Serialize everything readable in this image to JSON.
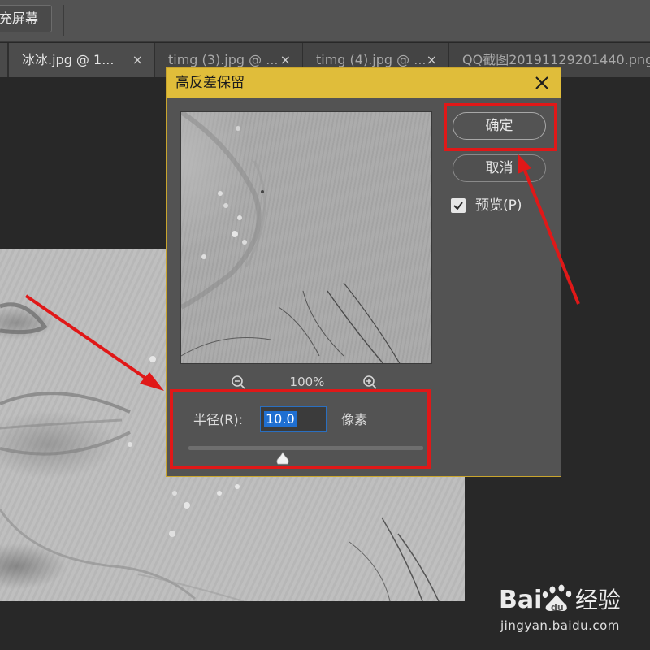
{
  "toolbar": {
    "fullscreen_label": "充屏幕"
  },
  "tabs": [
    {
      "label": "冰冰.jpg @ 1...",
      "close": "×",
      "active": true
    },
    {
      "label": "timg (3).jpg @ ...",
      "close": "×",
      "active": false
    },
    {
      "label": "timg (4).jpg @ ...",
      "close": "×",
      "active": false
    },
    {
      "label": "QQ截图20191129201440.png",
      "close": "",
      "active": false
    }
  ],
  "dialog": {
    "title": "高反差保留",
    "zoom": "100%",
    "radius_label": "半径(R):",
    "radius_value": "10.0",
    "unit": "像素",
    "radius_slider_fraction": 0.4,
    "ok_label": "确定",
    "cancel_label": "取消",
    "preview_label": "预览(P)",
    "preview_checked": true
  },
  "watermark": {
    "logo_text": "Baidu经验",
    "url": "jingyan.baidu.com"
  },
  "colors": {
    "title_bar": "#e0bd3a",
    "highlight": "#e01818",
    "selection": "#1f6fd1"
  }
}
